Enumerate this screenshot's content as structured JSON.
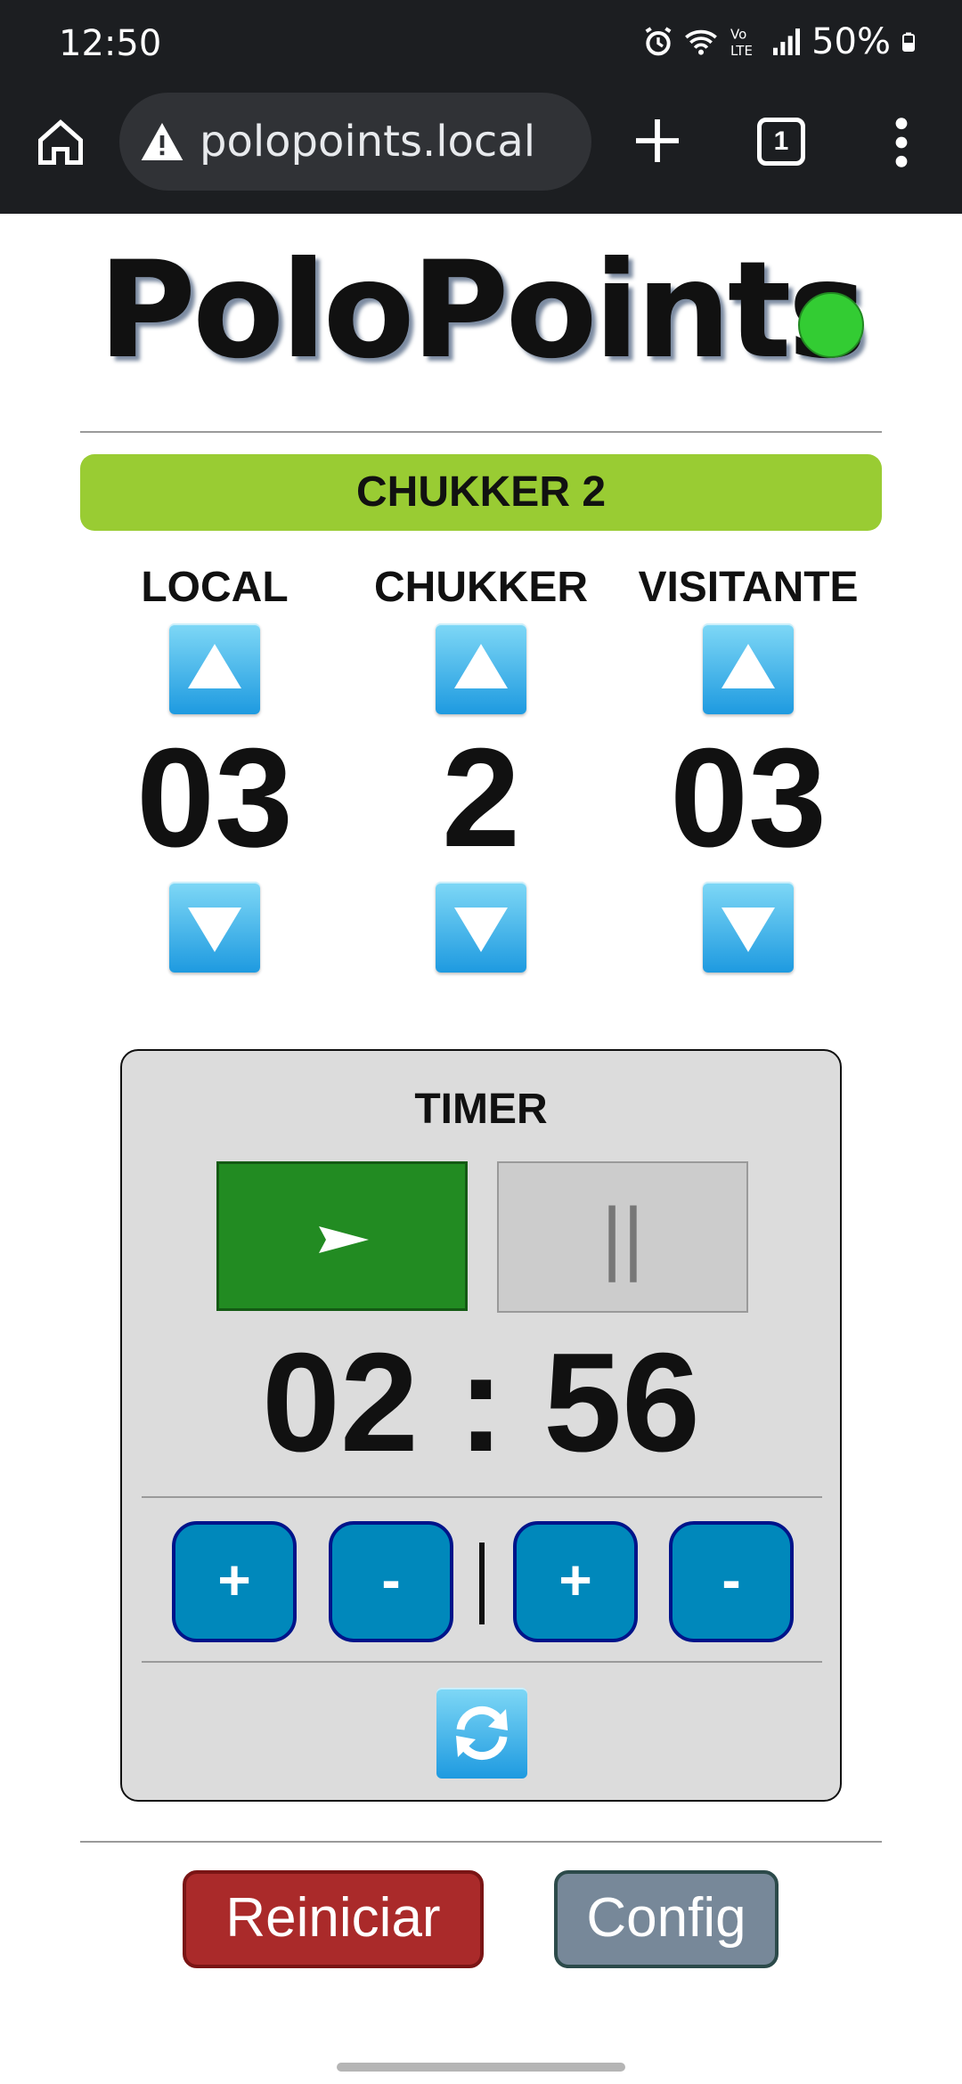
{
  "status_bar": {
    "time": "12:50",
    "battery": "50%",
    "icons": [
      "alarm-icon",
      "wifi-icon",
      "volte-icon",
      "signal-icon",
      "battery-icon"
    ]
  },
  "browser": {
    "url": "polopoints.local",
    "tab_count": "1",
    "icons": [
      "home-icon",
      "warning-icon",
      "new-tab-icon",
      "tab-switcher-icon",
      "more-menu-icon"
    ]
  },
  "app": {
    "title": "PoloPoints",
    "connection_status_color": "#33cc33"
  },
  "chukker_banner": "CHUKKER 2",
  "scoreboard": {
    "local": {
      "label": "LOCAL",
      "value": "03"
    },
    "chukker": {
      "label": "CHUKKER",
      "value": "2"
    },
    "visitante": {
      "label": "VISITANTE",
      "value": "03"
    }
  },
  "timer": {
    "label": "TIMER",
    "pause_glyph": "||",
    "display": "02 : 56",
    "adjust_buttons": [
      "+",
      "-",
      "+",
      "-"
    ]
  },
  "footer": {
    "reset_label": "Reiniciar",
    "config_label": "Config"
  },
  "colors": {
    "banner": "#99cc33",
    "play": "#228b22",
    "adjust": "#0088bb",
    "reset": "#aa2a2a",
    "config": "#778899"
  }
}
